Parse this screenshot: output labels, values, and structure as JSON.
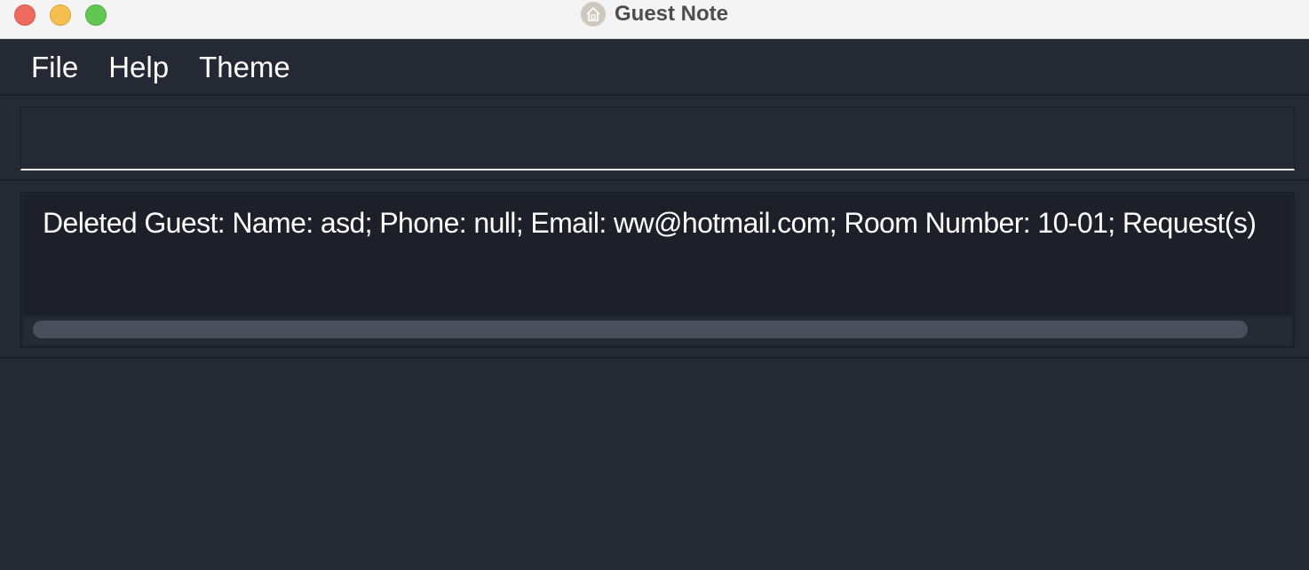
{
  "window": {
    "title": "Guest Note",
    "app_icon": "house-icon"
  },
  "menu": {
    "items": [
      {
        "label": "File"
      },
      {
        "label": "Help"
      },
      {
        "label": "Theme"
      }
    ]
  },
  "command": {
    "value": "",
    "placeholder": ""
  },
  "result": {
    "text": "Deleted Guest: Name: asd; Phone: null; Email: ww@hotmail.com; Room Number: 10-01; Request(s)"
  },
  "colors": {
    "background": "#262a33",
    "result_bg": "#1d2028",
    "text": "#ffffff",
    "close": "#ee6a5e",
    "minimize": "#f5bf4f",
    "maximize": "#62c655"
  }
}
